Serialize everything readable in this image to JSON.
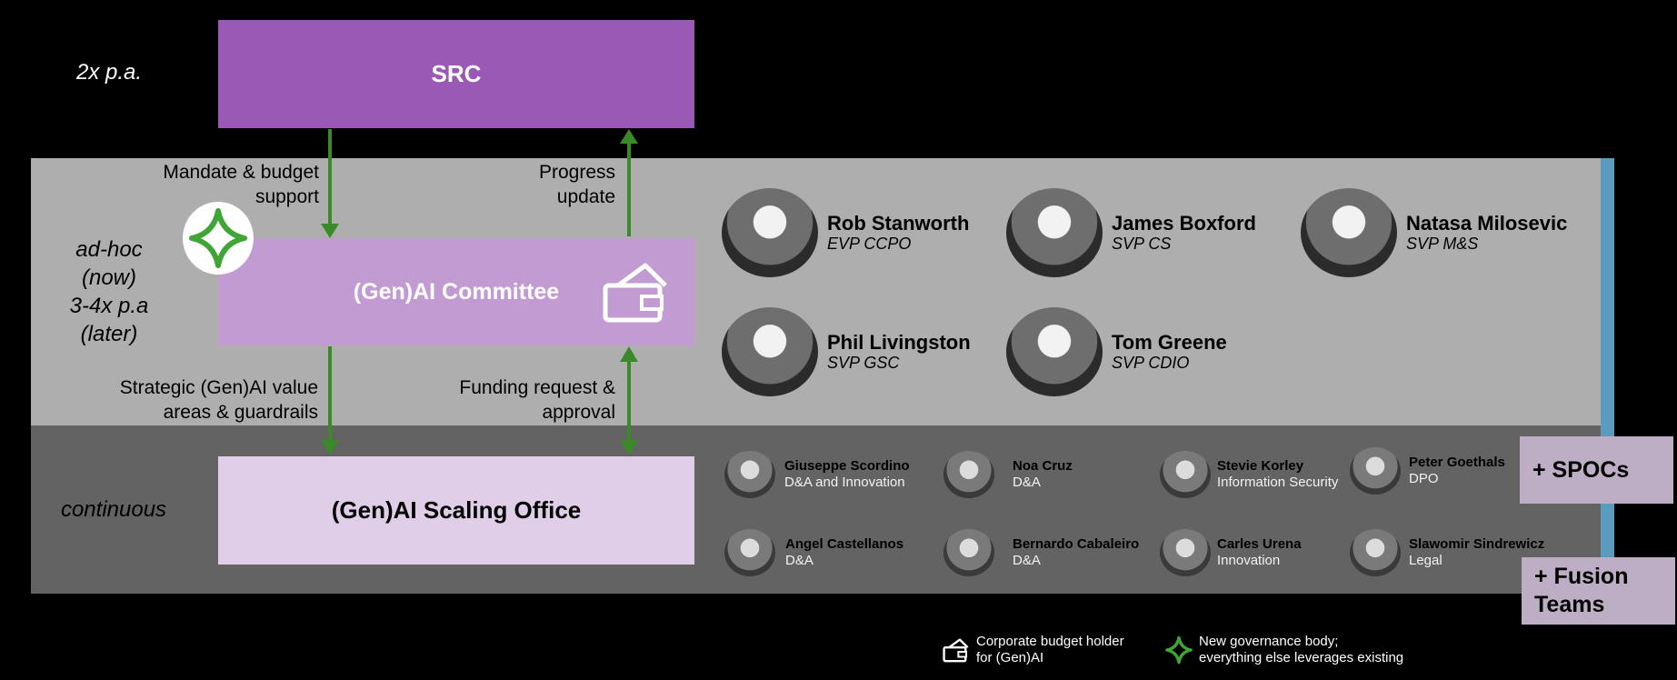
{
  "cadence": {
    "src": "2x p.a.",
    "committee_lines": [
      "ad-hoc",
      "(now)",
      "3-4x p.a",
      "(later)"
    ],
    "office": "continuous"
  },
  "boxes": {
    "src": "SRC",
    "committee": "(Gen)AI Committee",
    "office": "(Gen)AI Scaling Office"
  },
  "arrows": {
    "mandate": [
      "Mandate & budget",
      "support"
    ],
    "progress": [
      "Progress",
      "update"
    ],
    "strategic": [
      "Strategic (Gen)AI value",
      "areas & guardrails"
    ],
    "funding": [
      "Funding request &",
      "approval"
    ]
  },
  "committee_members": [
    {
      "name": "Rob Stanworth",
      "role": "EVP CCPO"
    },
    {
      "name": "James Boxford",
      "role": "SVP CS"
    },
    {
      "name": "Natasa Milosevic",
      "role": "SVP M&S"
    },
    {
      "name": "Phil Livingston",
      "role": "SVP GSC"
    },
    {
      "name": "Tom Greene",
      "role": "SVP CDIO"
    }
  ],
  "office_members": [
    {
      "name": "Giuseppe Scordino",
      "role": "D&A and Innovation"
    },
    {
      "name": "Noa Cruz",
      "role": "D&A"
    },
    {
      "name": "Stevie Korley",
      "role": "Information Security"
    },
    {
      "name": "Peter Goethals",
      "role": "DPO"
    },
    {
      "name": "Angel Castellanos",
      "role": "D&A"
    },
    {
      "name": "Bernardo Cabaleiro",
      "role": "D&A"
    },
    {
      "name": "Carles Urena",
      "role": "Innovation"
    },
    {
      "name": "Slawomir Sindrewicz",
      "role": "Legal"
    }
  ],
  "tags": {
    "spocs": "+ SPOCs",
    "fusion": [
      "+ Fusion",
      "Teams"
    ]
  },
  "legend": {
    "budget": [
      "Corporate budget holder",
      "for (Gen)AI"
    ],
    "governance": [
      "New governance body;",
      "everything else leverages existing"
    ]
  },
  "colors": {
    "src": "#9b59b6",
    "committee": "#c39bd3",
    "office": "#e0cde8",
    "arrow": "#3a8a2a",
    "star": "#3fa535"
  },
  "icons": {
    "budget": "wallet-card-icon",
    "governance": "four-point-star-icon"
  }
}
